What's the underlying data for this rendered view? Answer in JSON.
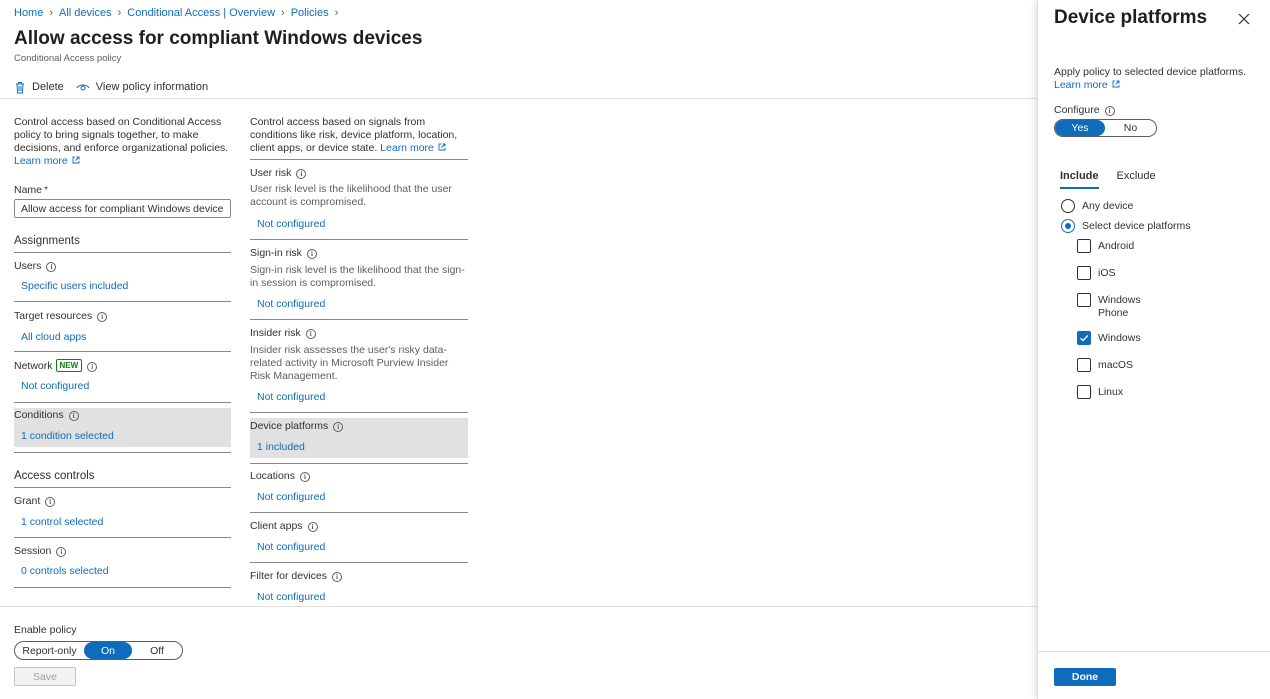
{
  "breadcrumb": [
    {
      "label": "Home"
    },
    {
      "label": "All devices"
    },
    {
      "label": "Conditional Access | Overview"
    },
    {
      "label": "Policies"
    }
  ],
  "page": {
    "title": "Allow access for compliant Windows devices",
    "more": "···",
    "subtitle": "Conditional Access policy"
  },
  "toolbar": {
    "delete_label": "Delete",
    "view_info_label": "View policy information"
  },
  "col1": {
    "desc": "Control access based on Conditional Access policy to bring signals together, to make decisions, and enforce organizational policies.",
    "learn_more": "Learn more",
    "name_label": "Name",
    "name_required": "*",
    "name_value": "Allow access for compliant Windows devices",
    "assignments_heading": "Assignments",
    "users_title": "Users",
    "users_value": "Specific users included",
    "target_title": "Target resources",
    "target_value": "All cloud apps",
    "network_title": "Network",
    "network_badge": "NEW",
    "network_value": "Not configured",
    "conditions_title": "Conditions",
    "conditions_value": "1 condition selected",
    "access_heading": "Access controls",
    "grant_title": "Grant",
    "grant_value": "1 control selected",
    "session_title": "Session",
    "session_value": "0 controls selected"
  },
  "col2": {
    "desc": "Control access based on signals from conditions like risk, device platform, location, client apps, or device state.",
    "learn_more": "Learn more",
    "user_risk_title": "User risk",
    "user_risk_desc": "User risk level is the likelihood that the user account is compromised.",
    "user_risk_value": "Not configured",
    "signin_risk_title": "Sign-in risk",
    "signin_risk_desc": "Sign-in risk level is the likelihood that the sign-in session is compromised.",
    "signin_risk_value": "Not configured",
    "insider_risk_title": "Insider risk",
    "insider_risk_desc": "Insider risk assesses the user's risky data-related activity in Microsoft Purview Insider Risk Management.",
    "insider_risk_value": "Not configured",
    "device_platforms_title": "Device platforms",
    "device_platforms_value": "1 included",
    "locations_title": "Locations",
    "locations_value": "Not configured",
    "client_apps_title": "Client apps",
    "client_apps_value": "Not configured",
    "filter_title": "Filter for devices",
    "filter_value": "Not configured"
  },
  "footer": {
    "enable_label": "Enable policy",
    "options": [
      "Report-only",
      "On",
      "Off"
    ],
    "selected": "On",
    "save_label": "Save"
  },
  "panel": {
    "title": "Device platforms",
    "desc": "Apply policy to selected device platforms.",
    "learn_more": "Learn more",
    "configure_label": "Configure",
    "configure_options": [
      "Yes",
      "No"
    ],
    "configure_selected": "Yes",
    "tabs": [
      "Include",
      "Exclude"
    ],
    "active_tab": "Include",
    "radio_any": "Any device",
    "radio_select": "Select device platforms",
    "radio_selected": "Select device platforms",
    "platforms": [
      {
        "label": "Android",
        "checked": false
      },
      {
        "label": "iOS",
        "checked": false
      },
      {
        "label": "Windows Phone",
        "checked": false
      },
      {
        "label": "Windows",
        "checked": true
      },
      {
        "label": "macOS",
        "checked": false
      },
      {
        "label": "Linux",
        "checked": false
      }
    ],
    "done_label": "Done"
  },
  "colors": {
    "accent": "#0f6cbd",
    "selected_row_bg": "#e1e1e1",
    "new_badge": "#107c10",
    "required": "#a4262c"
  }
}
